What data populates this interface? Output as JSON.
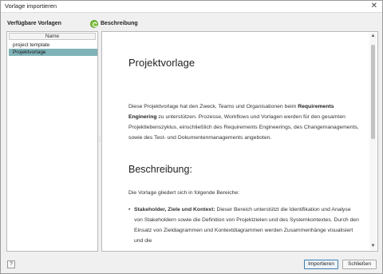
{
  "window": {
    "title": "Vorlage importieren"
  },
  "left": {
    "header": "Verfügbare Vorlagen",
    "column_header": "Name",
    "items": [
      {
        "label": "project template",
        "selected": false
      },
      {
        "label": "Projektvorlage",
        "selected": true
      }
    ]
  },
  "right": {
    "header": "Beschreibung",
    "header_icon": "refresh-icon",
    "doc_title": "Projektvorlage",
    "para_before": "Diese Projektvorlage hat den Zweck, Teams und Organisationen beim ",
    "para_bold": "Requirements Enginering",
    "para_after": " zu unterstützen. Prozesse, Workflows und Vorlagen werden für den gesamten Projektlebenszyklus, einschließlich des Requirements Engineerings, des Changemanagements, sowie des Test- und Dokumentenmanagements angeboten.",
    "section_title": "Beschreibung:",
    "intro": "Die Vorlage gliedert sich in folgende Bereiche:",
    "bullet_bold": "Stakeholder, Ziele und Kontext:",
    "bullet_text": " Dieser Bereich unterstützt die Identifikation und Analyse von Stakeholdern sowie die Definition von Projektzielen und des Systemkontextes. Durch den Einsatz von Zieldiagrammen und Kontextdiagrammen werden Zusammenhänge visualisiert und die"
  },
  "footer": {
    "help_label": "?",
    "import_label": "Importieren",
    "close_label": "Schließen"
  },
  "colors": {
    "selection": "#7fb3b8",
    "primary_border": "#3c7fb1",
    "icon_green": "#7bbf3a"
  }
}
